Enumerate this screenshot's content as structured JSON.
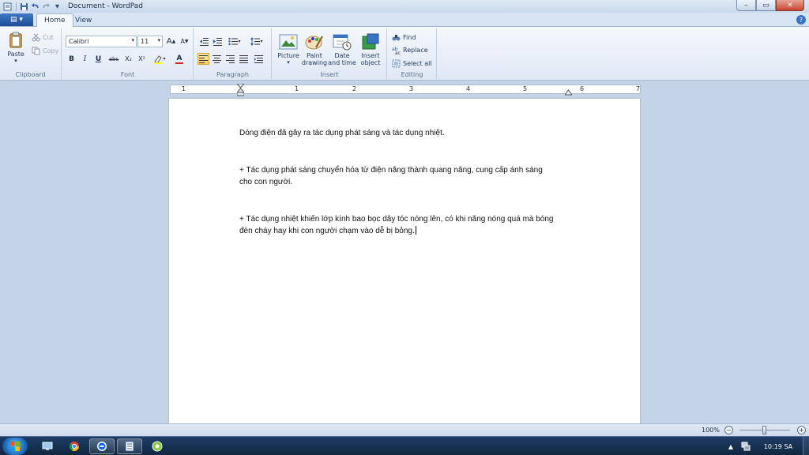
{
  "window": {
    "title": "Document - WordPad",
    "minimize": "–",
    "maximize": "▭",
    "close": "✕"
  },
  "quick_access": {
    "save": "💾",
    "undo": "↶",
    "redo": "↷",
    "customize": "▾"
  },
  "app_button": {
    "label": "▤ ▾"
  },
  "tabs": [
    {
      "label": "Home",
      "active": true
    },
    {
      "label": "View",
      "active": false
    }
  ],
  "help": "?",
  "ribbon": {
    "clipboard": {
      "label": "Clipboard",
      "paste": "Paste",
      "cut": "Cut",
      "copy": "Copy"
    },
    "font": {
      "label": "Font",
      "family": "Calibri",
      "size": "11",
      "grow": "A",
      "shrink": "A",
      "bold": "B",
      "italic": "I",
      "underline": "U",
      "strike": "abc",
      "subscript": "X₂",
      "superscript": "X²",
      "text_color": "A"
    },
    "paragraph": {
      "label": "Paragraph"
    },
    "insert": {
      "label": "Insert",
      "picture": "Picture",
      "paint": "Paint drawing",
      "datetime": "Date and time",
      "object": "Insert object"
    },
    "editing": {
      "label": "Editing",
      "find": "Find",
      "replace": "Replace",
      "select_all": "Select all"
    }
  },
  "ruler": {
    "numbers": [
      "1",
      "1",
      "2",
      "3",
      "4",
      "5",
      "6",
      "7"
    ]
  },
  "document": {
    "paragraphs": [
      "Dòng điện đã gây ra tác dụng phát sáng và tác dụng nhiệt.",
      "+ Tác dụng phát sáng chuyển hóa từ điện năng thành quang năng, cung cấp ánh sáng cho con người.",
      "+ Tác dụng nhiệt khiến lớp kính bao bọc dây tóc nóng lên, có khi năng nóng quá mà bóng đèn cháy hay khi con người chạm vào dễ bị bỏng."
    ]
  },
  "status": {
    "zoom": "100%",
    "zoom_level": 0.5,
    "minus": "−",
    "plus": "+"
  },
  "taskbar": {
    "tray_arrow": "▲",
    "clock": "10:19 SA"
  },
  "colors": {
    "accent": "#1d4e99",
    "ribbon_bg": "#f5f8fc",
    "workspace_bg": "#c5d3e6",
    "taskbar": "#1d3c66"
  }
}
